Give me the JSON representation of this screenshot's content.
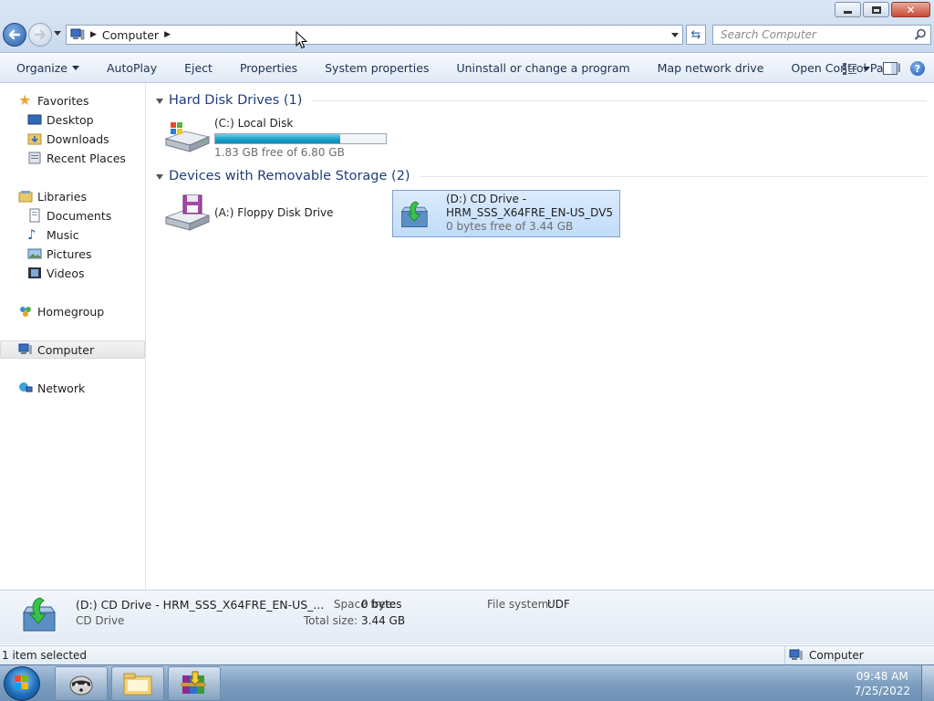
{
  "window": {
    "breadcrumb": [
      "Computer"
    ],
    "search_placeholder": "Search Computer"
  },
  "toolbar": {
    "items": [
      "Organize",
      "AutoPlay",
      "Eject",
      "Properties",
      "System properties",
      "Uninstall or change a program",
      "Map network drive",
      "Open Control Panel"
    ]
  },
  "sidebar": {
    "favorites": {
      "label": "Favorites",
      "items": [
        "Desktop",
        "Downloads",
        "Recent Places"
      ]
    },
    "libraries": {
      "label": "Libraries",
      "items": [
        "Documents",
        "Music",
        "Pictures",
        "Videos"
      ]
    },
    "homegroup": "Homegroup",
    "computer": "Computer",
    "network": "Network"
  },
  "groups": {
    "hdd": {
      "title": "Hard Disk Drives (1)",
      "drives": [
        {
          "name": "(C:) Local Disk",
          "free_text": "1.83 GB free of 6.80 GB",
          "used_fraction": 0.73
        }
      ]
    },
    "removable": {
      "title": "Devices with Removable Storage (2)",
      "drives": [
        {
          "name": "(A:) Floppy Disk Drive"
        },
        {
          "name_line1": "(D:) CD Drive -",
          "name_line2": "HRM_SSS_X64FRE_EN-US_DV5",
          "free_text": "0 bytes free of 3.44 GB"
        }
      ]
    }
  },
  "details": {
    "title": "(D:) CD Drive - HRM_SSS_X64FRE_EN-US_...",
    "type": "CD Drive",
    "space_free_label": "Space free:",
    "space_free": "0 bytes",
    "total_size_label": "Total size:",
    "total_size": "3.44 GB",
    "file_system_label": "File system:",
    "file_system": "UDF"
  },
  "status": {
    "selection": "1 item selected",
    "location": "Computer"
  },
  "taskbar": {
    "time": "09:48 AM",
    "date": "7/25/2022"
  },
  "colors": {
    "accent": "#1aa0c8",
    "selection_bg": "#c1dcf9",
    "group_header": "#1e3d7a"
  }
}
